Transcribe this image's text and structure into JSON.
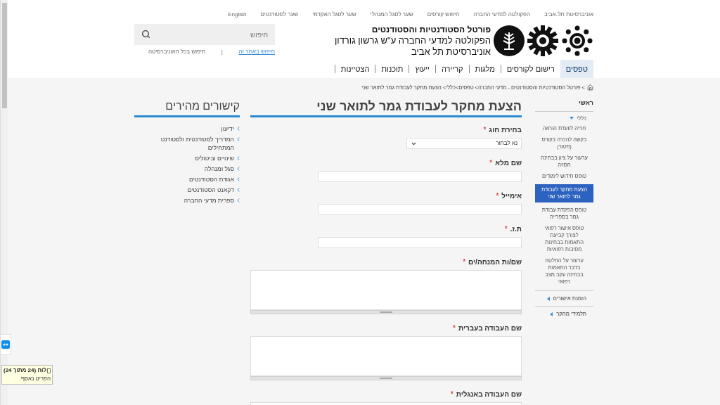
{
  "top_links": [
    "אוניברסיטת תל-אביב",
    "הפקולטה למדעי החברה",
    "חיפוש קורסים",
    "שער לסגל המנהלי",
    "שער לסגל האקדמי",
    "שער לסטודנטים",
    "English"
  ],
  "header": {
    "title_lines": [
      "פורטל הסטודנטיות והסטודנטים",
      "הפקולטה למדעי החברה ע\"ש גרשון גורדון",
      "אוניברסיטת תל אביב"
    ]
  },
  "search": {
    "placeholder": "חיפוש",
    "scopes": [
      {
        "label": "חיפוש באתר זה",
        "selected": true
      },
      {
        "label": "חיפוש בכל האוניברסיטה",
        "selected": false
      }
    ],
    "separator": "|"
  },
  "nav": [
    {
      "label": "טפסים",
      "selected": true
    },
    {
      "label": "רישום לקורסים",
      "selected": false
    },
    {
      "label": "מלגות",
      "selected": false
    },
    {
      "label": "קריירה",
      "selected": false
    },
    {
      "label": "ייעוץ",
      "selected": false
    },
    {
      "label": "תוכנות",
      "selected": false
    },
    {
      "label": "הצטיינות",
      "selected": false
    }
  ],
  "breadcrumb": "> פורטל הסטודנטיות והסטודנטים - מדעי החברה> טפסים>כללי> הצעת מחקר לעבודת גמר לתואר שני",
  "sidebar": {
    "heading": "ראשי",
    "items": [
      {
        "label": "כללי",
        "expanded": true,
        "children": [
          {
            "label": "פנייה לוועדת הוראה",
            "selected": false
          },
          {
            "label": "בקשה להכרה בקורס (פטור)",
            "selected": false
          },
          {
            "label": "ערעור על ציון בבחינה חסויה",
            "selected": false
          },
          {
            "label": "טופס חידוש לימודים",
            "selected": false
          },
          {
            "label": "הצעת מחקר לעבודת גמר לתואר שני",
            "selected": true
          },
          {
            "label": "טופס הפקדת עבודת גמר בספרייה",
            "selected": false
          },
          {
            "label": "טופס אישור רפואי לצורך קביעת התאמות בבחינות מסיבות רפואיות",
            "selected": false
          },
          {
            "label": "ערעור על החלטה בדבר התאמות בבחינה עקב מצב רפואי",
            "selected": false
          }
        ]
      },
      {
        "label": "הזמנת אישורים",
        "expanded": false
      },
      {
        "label": "תלמידי מחקר",
        "expanded": false
      }
    ]
  },
  "form": {
    "title": "הצעת מחקר לעבודת גמר לתואר שני",
    "required_mark": "*",
    "fields": [
      {
        "kind": "select",
        "label": "בחירת חוג",
        "required": true,
        "value": "נא לבחור"
      },
      {
        "kind": "input",
        "label": "שם מלא",
        "required": true
      },
      {
        "kind": "input",
        "label": "אימייל",
        "required": true
      },
      {
        "kind": "input",
        "label": "ת.ז.",
        "required": true
      },
      {
        "kind": "textarea",
        "label": "שם/ות המנחה/ים",
        "required": true
      },
      {
        "kind": "textarea",
        "label": "שם העבודה בעברית",
        "required": true
      },
      {
        "kind": "textarea",
        "label": "שם העבודה באנגלית",
        "required": true
      }
    ]
  },
  "quick_links": {
    "title": "קישורים מהירים",
    "items": [
      "ידיעון",
      "המדריך לסטודנטית ולסטודנט המתחילים",
      "שינויים וביטולים",
      "סגל ומנהלה",
      "אגודת הסטודנטים",
      "דקאנט הסטודנטים",
      "ספרית מדעי החברה"
    ]
  },
  "tooltip": {
    "title": "לוח (24 מתוך 24)",
    "text": "הפריט נאסף."
  }
}
